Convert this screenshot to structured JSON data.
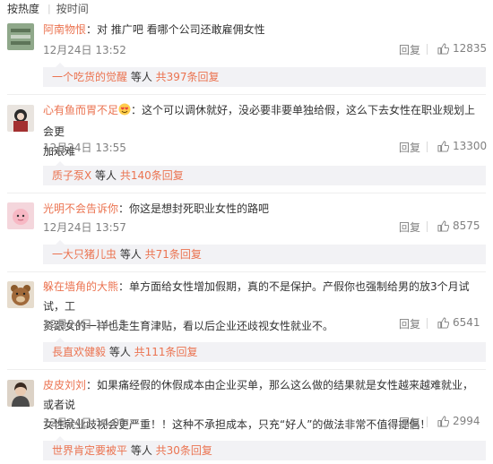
{
  "sort_bar": {
    "hot": "按热度",
    "time": "按时间",
    "separator": "|"
  },
  "comments": [
    {
      "user": "阿南物恨",
      "colon": "：",
      "text": "对 推广吧 看哪个公司还敢雇佣女性",
      "time": "12月24日 13:52",
      "reply_label": "回复",
      "likes": "12835",
      "thread_user": "一个吃货的觉醒",
      "thread_mid": " 等人 ",
      "thread_count": "共397条回复"
    },
    {
      "user": "心有鱼而胃不足",
      "colon": "：",
      "text_line1": "这个可以调休就好，没必要非要单独给假，这么下去女性在职业规划上会更",
      "text_line2": "加艰难",
      "time": "12月24日 13:55",
      "reply_label": "回复",
      "likes": "13300",
      "thread_user": "质子泵X",
      "thread_mid": " 等人 ",
      "thread_count": "共140条回复"
    },
    {
      "user": "光明不会告诉你",
      "colon": "：",
      "text": "你这是想封死职业女性的路吧",
      "time": "12月24日 13:57",
      "reply_label": "回复",
      "likes": "8575",
      "thread_user": "一大只猪儿虫",
      "thread_mid": " 等人 ",
      "thread_count": "共71条回复"
    },
    {
      "user": "躲在墙角的大熊",
      "colon": "：",
      "text_line1": "单方面给女性增加假期，真的不是保护。产假你也强制给男的放3个月试试，工",
      "text_line2": "资跟女的一样也走生育津贴，看以后企业还歧视女性就业不。",
      "time": "12月24日 14:15",
      "reply_label": "回复",
      "likes": "6541",
      "thread_user": "長直欢健毅",
      "thread_mid": " 等人 ",
      "thread_count": "共111条回复"
    },
    {
      "user": "皮皮刘刘",
      "colon": "：",
      "text_line1": "如果痛经假的休假成本由企业买单，那么这么做的结果就是女性越来越难就业，或者说",
      "text_line2": "女性就业歧视会更严重！！这种不承担成本，只充“好人”的做法非常不值得提倡！",
      "time": "12月24日 14:01",
      "reply_label": "回复",
      "likes": "2994",
      "thread_user": "世界肯定要被平",
      "thread_mid": " 等人 ",
      "thread_count": "共30条回复"
    }
  ],
  "colors": {
    "username": "#eb7350",
    "meta": "#808080",
    "reply_bg": "#f2f2f5"
  },
  "icons": {
    "like": "thumbs-up-icon",
    "emoji": "heart-eyes-emoji-icon"
  }
}
